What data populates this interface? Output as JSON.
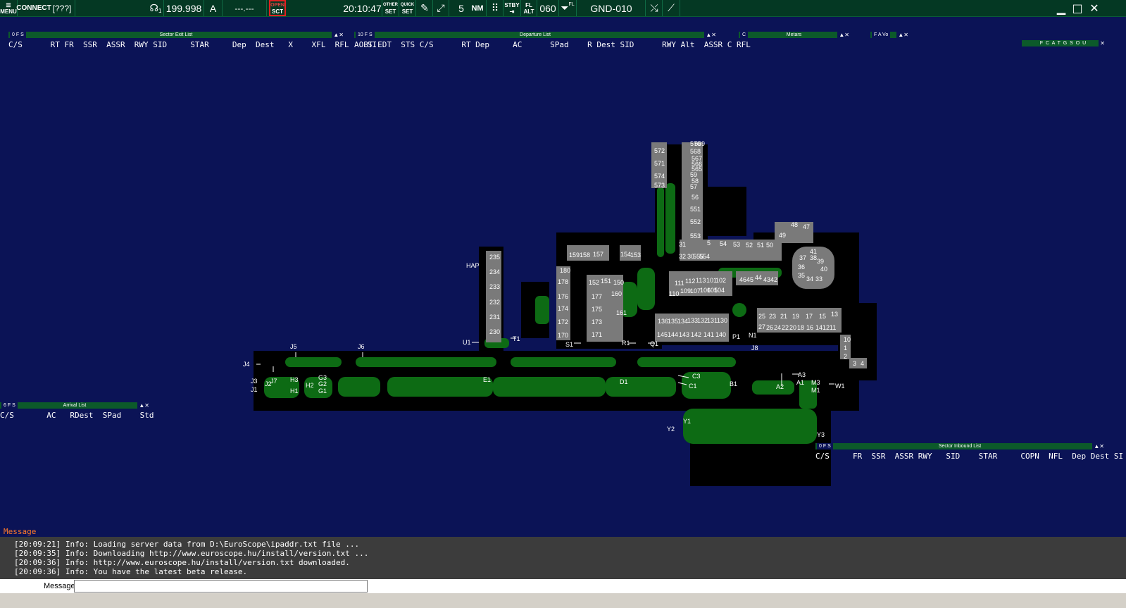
{
  "toolbar": {
    "menu_label": "MENU",
    "connect_label": "CONNECT",
    "callsign": "[???]",
    "headset_sub": "1",
    "frequency": "199.998",
    "atis_letter": "A",
    "secondary_freq": "---.---",
    "open_label": "OPEN",
    "sct_label": "SCT",
    "time": "20:10:47",
    "other_label": "OTHER",
    "other_set": "SET",
    "quick_label": "QUICK",
    "quick_set": "SET",
    "range": "5",
    "range_unit": "NM",
    "stby_label": "STBY",
    "fl_label": "FL",
    "alt_label": "ALT",
    "fl_value": "060",
    "filter_sup": "FL",
    "profile": "GND-010"
  },
  "sector_exit_list": {
    "count": "0",
    "flags": "F S",
    "title": "Sector Exit List",
    "columns": "C/S      RT FR  SSR  ASSR  RWY SID     STAR     Dep  Dest   X    XFL  RFL    SI"
  },
  "departure_list": {
    "count": "10",
    "flags": "F S",
    "title": "Departure List",
    "columns": "AOBT EDT  STS C/S      RT Dep     AC      SPad    R Dest SID      RWY Alt  ASSR C RFL"
  },
  "metars": {
    "flags": "C",
    "title": "Metars"
  },
  "small_box": {
    "flags": "F A Vo"
  },
  "fca_box": {
    "title": "F C A T G S O U"
  },
  "arrival_list": {
    "count": "6",
    "flags": "F S",
    "title": "Arrival List",
    "columns": "C/S       AC   RDest  SPad    Std"
  },
  "sector_inbound_list": {
    "count": "0",
    "flags": "F S",
    "title": "Sector Inbound List",
    "columns": "C/S     FR  SSR  ASSR RWY   SID    STAR     COPN  NFL  Dep Dest SI"
  },
  "message": {
    "label": "Message",
    "lines": [
      "[20:09:21] Info: Loading server data from D:\\EuroScope\\ipaddr.txt file ...",
      "[20:09:35] Info: Downloading http://www.euroscope.hu/install/version.txt ...",
      "[20:09:36] Info: http://www.euroscope.hu/install/version.txt downloaded.",
      "[20:09:36] Info: You have the latest beta release."
    ],
    "input_label": "Message"
  },
  "map_labels": {
    "j5": "J5",
    "j6": "J6",
    "j4": "J4",
    "j3": "J3",
    "j1": "J1",
    "j7": "J7",
    "j2": "J2",
    "h3": "H3",
    "h1": "H1",
    "h2": "H2",
    "g3": "G3",
    "g2": "G2",
    "g1": "G1",
    "e1": "E1",
    "d1": "D1",
    "c3": "C3",
    "c1": "C1",
    "b1": "B1",
    "a2": "A2",
    "a3": "A3",
    "a1": "A1",
    "m3": "M3",
    "m1": "M1",
    "w1": "W1",
    "y1": "Y1",
    "y2": "Y2",
    "y3": "Y3",
    "u1": "U1",
    "t1": "T1",
    "s1": "S1",
    "r1": "R1",
    "q1": "Q1",
    "p1": "P1",
    "n1": "N1",
    "j8": "J8",
    "hap": "HAP",
    "stands": [
      "235",
      "234",
      "233",
      "232",
      "231",
      "230",
      "180",
      "178",
      "176",
      "174",
      "172",
      "170",
      "159",
      "158",
      "157",
      "154",
      "153",
      "152",
      "151",
      "150",
      "177",
      "175",
      "173",
      "171",
      "160",
      "161",
      "111",
      "112",
      "113",
      "101",
      "102",
      "109",
      "107",
      "106",
      "105",
      "104",
      "110",
      "136",
      "135",
      "134",
      "133",
      "132",
      "131",
      "130",
      "145",
      "144",
      "143",
      "142",
      "141",
      "140",
      "25",
      "23",
      "21",
      "19",
      "17",
      "15",
      "13",
      "27",
      "26",
      "24",
      "22",
      "20",
      "18",
      "16",
      "14",
      "12",
      "11",
      "10",
      "1",
      "2",
      "3",
      "4",
      "5",
      "54",
      "53",
      "52",
      "51",
      "50",
      "49",
      "48",
      "47",
      "46",
      "45",
      "44",
      "43",
      "42",
      "41",
      "40",
      "39",
      "38",
      "37",
      "36",
      "35",
      "34",
      "33",
      "32",
      "31",
      "30",
      "555",
      "554",
      "553",
      "552",
      "551",
      "56",
      "57",
      "58",
      "59",
      "565",
      "566",
      "567",
      "568",
      "569",
      "570",
      "571",
      "572",
      "573",
      "574",
      "65",
      "64",
      "63",
      "66"
    ]
  }
}
